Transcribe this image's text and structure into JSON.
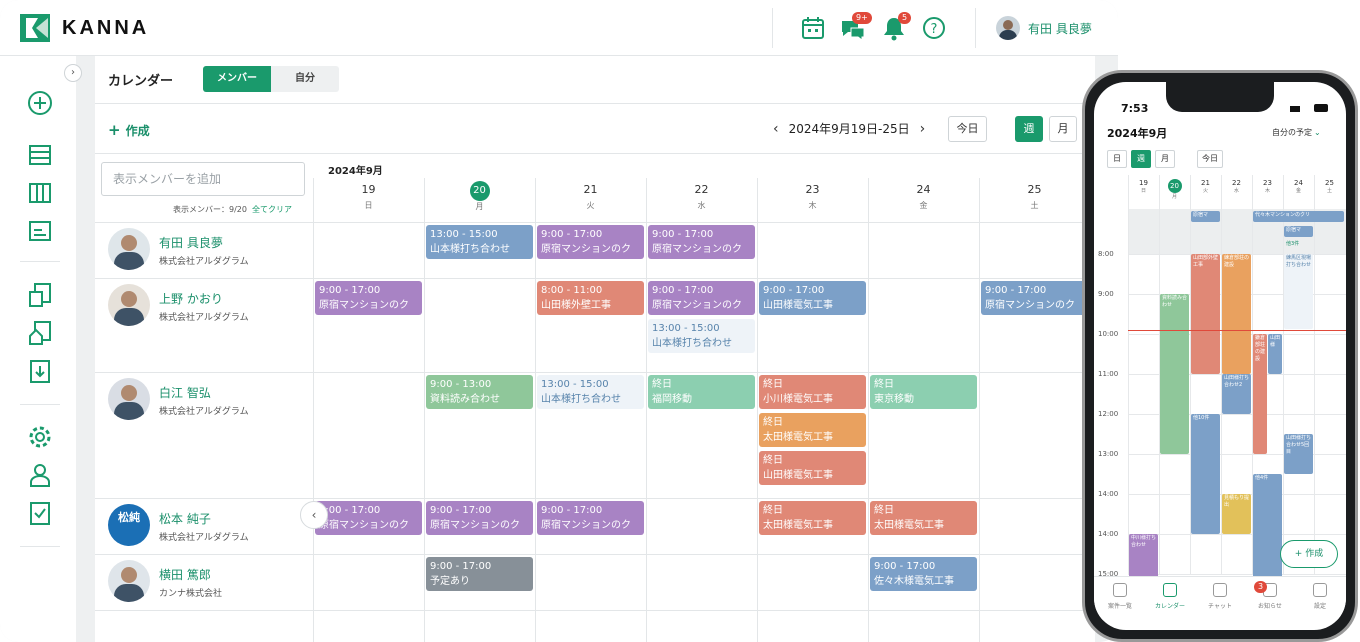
{
  "app": {
    "name": "KANNA"
  },
  "header": {
    "chat_badge": "9+",
    "notif_badge": "5",
    "user_name": "有田 具良夢"
  },
  "calendar": {
    "title": "カレンダー",
    "tab_members": "メンバー",
    "tab_self": "自分",
    "create": "作成",
    "range": "2024年9月19日-25日",
    "today": "今日",
    "week": "週",
    "month": "月",
    "search_placeholder": "表示メンバーを追加",
    "member_count": "表示メンバー：9/20",
    "clear_all": "全てクリア",
    "month_label": "2024年9月",
    "days": [
      {
        "n": "19",
        "w": "日"
      },
      {
        "n": "20",
        "w": "月"
      },
      {
        "n": "21",
        "w": "火"
      },
      {
        "n": "22",
        "w": "水"
      },
      {
        "n": "23",
        "w": "木"
      },
      {
        "n": "24",
        "w": "金"
      },
      {
        "n": "25",
        "w": "土"
      }
    ],
    "members": [
      {
        "name": "有田 具良夢",
        "company": "株式会社アルダグラム"
      },
      {
        "name": "上野 かおり",
        "company": "株式会社アルダグラム"
      },
      {
        "name": "白江 智弘",
        "company": "株式会社アルダグラム"
      },
      {
        "name": "松本 純子",
        "company": "株式会社アルダグラム",
        "avatar_text": "松純"
      },
      {
        "name": "横田 篤郎",
        "company": "カンナ株式会社"
      }
    ],
    "events": [
      {
        "row": 0,
        "day": 1,
        "time": "13:00 - 15:00",
        "title": "山本様打ち合わせ",
        "color": "blue"
      },
      {
        "row": 0,
        "day": 2,
        "time": "9:00 - 17:00",
        "title": "原宿マンションのク",
        "color": "purple"
      },
      {
        "row": 0,
        "day": 3,
        "time": "9:00 - 17:00",
        "title": "原宿マンションのク",
        "color": "purple"
      },
      {
        "row": 1,
        "day": 0,
        "time": "9:00 - 17:00",
        "title": "原宿マンションのク",
        "color": "purple"
      },
      {
        "row": 1,
        "day": 2,
        "time": "8:00 - 11:00",
        "title": "山田様外壁工事",
        "color": "red"
      },
      {
        "row": 1,
        "day": 3,
        "time": "9:00 - 17:00",
        "title": "原宿マンションのク",
        "color": "purple"
      },
      {
        "row": 1,
        "day": 3,
        "slot": 1,
        "time": "13:00 - 15:00",
        "title": "山本様打ち合わせ",
        "color": "light"
      },
      {
        "row": 1,
        "day": 4,
        "time": "9:00 - 17:00",
        "title": "山田様電気工事",
        "color": "blue"
      },
      {
        "row": 1,
        "day": 6,
        "time": "9:00 - 17:00",
        "title": "原宿マンションのク",
        "color": "blue"
      },
      {
        "row": 2,
        "day": 1,
        "time": "9:00 - 13:00",
        "title": "資料読み合わせ",
        "color": "mgreen"
      },
      {
        "row": 2,
        "day": 2,
        "time": "13:00 - 15:00",
        "title": "山本様打ち合わせ",
        "color": "light"
      },
      {
        "row": 2,
        "day": 3,
        "time": "終日",
        "title": "福岡移動",
        "color": "green"
      },
      {
        "row": 2,
        "day": 4,
        "time": "終日",
        "title": "小川様電気工事",
        "color": "red"
      },
      {
        "row": 2,
        "day": 4,
        "slot": 1,
        "time": "終日",
        "title": "太田様電気工事",
        "color": "orange"
      },
      {
        "row": 2,
        "day": 4,
        "slot": 2,
        "time": "終日",
        "title": "山田様電気工事",
        "color": "red"
      },
      {
        "row": 2,
        "day": 5,
        "time": "終日",
        "title": "東京移動",
        "color": "green"
      },
      {
        "row": 3,
        "day": 0,
        "time": "9:00 - 17:00",
        "title": "原宿マンションのク",
        "color": "purple"
      },
      {
        "row": 3,
        "day": 1,
        "time": "9:00 - 17:00",
        "title": "原宿マンションのク",
        "color": "purple"
      },
      {
        "row": 3,
        "day": 2,
        "time": "9:00 - 17:00",
        "title": "原宿マンションのク",
        "color": "purple"
      },
      {
        "row": 3,
        "day": 4,
        "time": "終日",
        "title": "太田様電気工事",
        "color": "red"
      },
      {
        "row": 3,
        "day": 5,
        "time": "終日",
        "title": "太田様電気工事",
        "color": "red"
      },
      {
        "row": 4,
        "day": 1,
        "time": "9:00 - 17:00",
        "title": "予定あり",
        "color": "gray"
      },
      {
        "row": 4,
        "day": 5,
        "time": "9:00 - 17:00",
        "title": "佐々木様電気工事",
        "color": "blue"
      }
    ]
  },
  "phone": {
    "time": "7:53",
    "month": "2024年9月",
    "self_schedule": "自分の予定",
    "day_btn": "日",
    "week_btn": "週",
    "month_btn": "月",
    "today_btn": "今日",
    "create": "作成",
    "days": [
      {
        "n": "19",
        "w": "日"
      },
      {
        "n": "20",
        "w": "月"
      },
      {
        "n": "21",
        "w": "火"
      },
      {
        "n": "22",
        "w": "水"
      },
      {
        "n": "23",
        "w": "木"
      },
      {
        "n": "24",
        "w": "金"
      },
      {
        "n": "25",
        "w": "土"
      }
    ],
    "hours": [
      "8:00",
      "9:00",
      "10:00",
      "11:00",
      "12:00",
      "13:00",
      "14:00",
      "14:00",
      "15:00"
    ],
    "events": [
      "原宿マ",
      "代々木マンションのクリ",
      "原宿マ",
      "他3件",
      "山田部外壁工事",
      "練倉部荘の建設",
      "練馬区現場打ち合わせ",
      "資料読み合わせ",
      "鎌倉部荘の建設",
      "山田様",
      "山田様打ち合わせ2",
      "他10件",
      "山田様打ち合わせ5回目",
      "見積もり提出",
      "他4件",
      "中川様打ち合わせ"
    ],
    "nav": [
      "案件一覧",
      "カレンダー",
      "チャット",
      "お知らせ",
      "設定"
    ],
    "nav_badge": "3"
  }
}
